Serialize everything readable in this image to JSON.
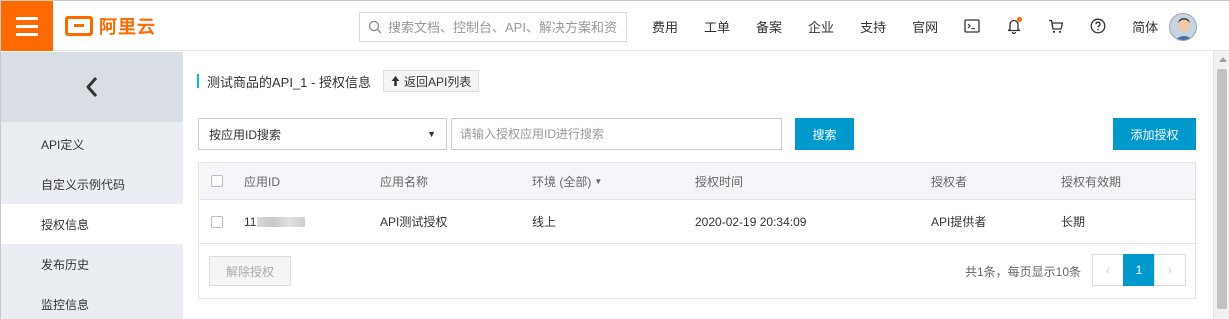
{
  "header": {
    "logo_text": "阿里云",
    "search_placeholder": "搜索文档、控制台、API、解决方案和资源",
    "nav": [
      "费用",
      "工单",
      "备案",
      "企业",
      "支持",
      "官网"
    ],
    "icons": [
      "terminal-icon",
      "bell-icon",
      "cart-icon",
      "help-icon"
    ],
    "language": "简体",
    "accent": "#ff6a00"
  },
  "sidebar": {
    "items": [
      {
        "label": "API定义",
        "active": false
      },
      {
        "label": "自定义示例代码",
        "active": false
      },
      {
        "label": "授权信息",
        "active": true
      },
      {
        "label": "发布历史",
        "active": false
      },
      {
        "label": "监控信息",
        "active": false
      }
    ]
  },
  "main": {
    "title": "测试商品的API_1 - 授权信息",
    "back_label": "返回API列表",
    "filter_select": "按应用ID搜索",
    "filter_placeholder": "请输入授权应用ID进行搜索",
    "search_label": "搜索",
    "add_label": "添加授权",
    "primary_color": "#0099cc",
    "table": {
      "headers": [
        "应用ID",
        "应用名称",
        "环境 (全部)",
        "授权时间",
        "授权者",
        "授权有效期"
      ],
      "rows": [
        {
          "app_id": "11",
          "app_name": "API测试授权",
          "env": "线上",
          "time": "2020-02-19 20:34:09",
          "grantor": "API提供者",
          "validity": "长期"
        }
      ]
    },
    "revoke_label": "解除授权",
    "page_info": "共1条，每页显示10条",
    "current_page": "1",
    "prev_symbol": "‹",
    "next_symbol": "›"
  }
}
